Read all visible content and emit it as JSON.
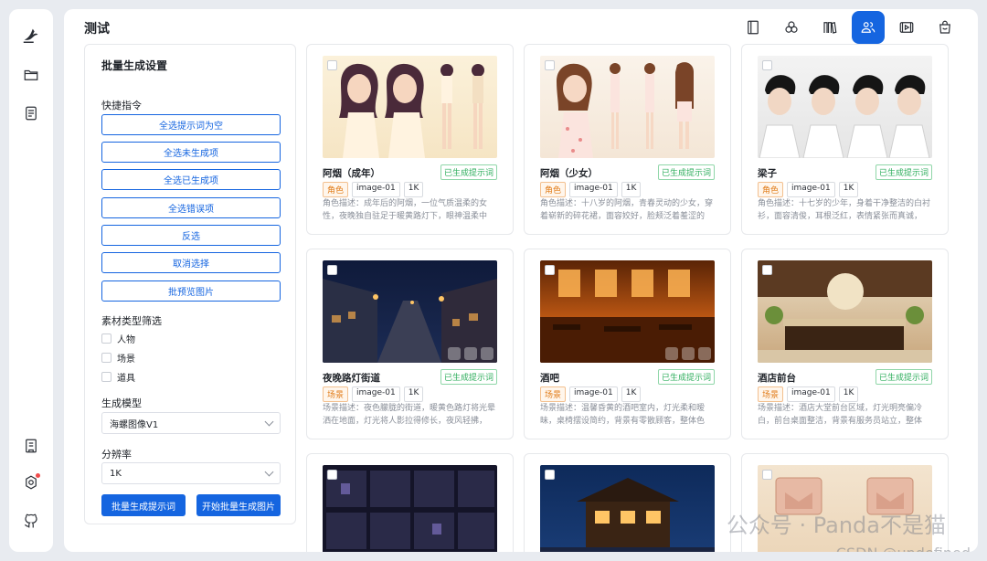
{
  "app": {
    "title": "测试"
  },
  "rail": {
    "icons": [
      "logo-icon",
      "folder-icon",
      "document-list-icon",
      "book-icon",
      "settings-icon",
      "github-icon"
    ]
  },
  "toolbar": {
    "icons": [
      "book-icon",
      "palette-icon",
      "library-icon",
      "users-icon",
      "video-icon",
      "bag-icon"
    ],
    "active_index": 3
  },
  "panel": {
    "title": "批量生成设置",
    "quick_label": "快捷指令",
    "quick_buttons": [
      "全选提示词为空",
      "全选未生成项",
      "全选已生成项",
      "全选错误项",
      "反选",
      "取消选择",
      "批预览图片"
    ],
    "filter_label": "素材类型筛选",
    "filters": [
      "人物",
      "场景",
      "道具"
    ],
    "model_label": "生成模型",
    "model_value": "海螺图像V1",
    "resolution_label": "分辨率",
    "resolution_value": "1K",
    "gen_prompt_button": "批量生成提示词",
    "gen_image_button": "开始批量生成图片"
  },
  "cards": [
    {
      "name": "阿烟（成年）",
      "status": "已生成提示词",
      "type": "角色",
      "model": "image-01",
      "res": "1K",
      "desc": "角色描述：成年后的阿烟，一位气质温柔的女性，夜晚独自驻足于暖黄路灯下，眼神温柔中带..."
    },
    {
      "name": "阿烟（少女）",
      "status": "已生成提示词",
      "type": "角色",
      "model": "image-01",
      "res": "1K",
      "desc": "角色描述：十八岁的阿烟，青春灵动的少女，穿着崭新的碎花裙，面容姣好，脸颊泛着羞涩的红..."
    },
    {
      "name": "梁子",
      "status": "已生成提示词",
      "type": "角色",
      "model": "image-01",
      "res": "1K",
      "desc": "角色描述：十七岁的少年，身着干净整洁的白衬衫，面容清俊，耳根泛红，表情紧张而真诚，眼..."
    },
    {
      "name": "夜晚路灯街道",
      "status": "已生成提示词",
      "type": "场景",
      "model": "image-01",
      "res": "1K",
      "desc": "场景描述：夜色朦胧的街道，暖黄色路灯将光晕洒在地面，灯光将人影拉得修长，夜风轻拂，氛..."
    },
    {
      "name": "酒吧",
      "status": "已生成提示词",
      "type": "场景",
      "model": "image-01",
      "res": "1K",
      "desc": "场景描述：温馨昏黄的酒吧室内，灯光柔和暧昧，桌椅摆设简约，背景有零散顾客，整体色调..."
    },
    {
      "name": "酒店前台",
      "status": "已生成提示词",
      "type": "场景",
      "model": "image-01",
      "res": "1K",
      "desc": "场景描述：酒店大堂前台区域，灯光明亮偏冷白，前台桌面整洁，背景有服务员站立，整体空..."
    }
  ],
  "watermark": {
    "line1": "公众号 · Panda不是猫",
    "line2": "CSDN @undefined"
  },
  "colors": {
    "accent": "#1565e0",
    "success": "#2fae5d",
    "warning": "#e07b17"
  }
}
